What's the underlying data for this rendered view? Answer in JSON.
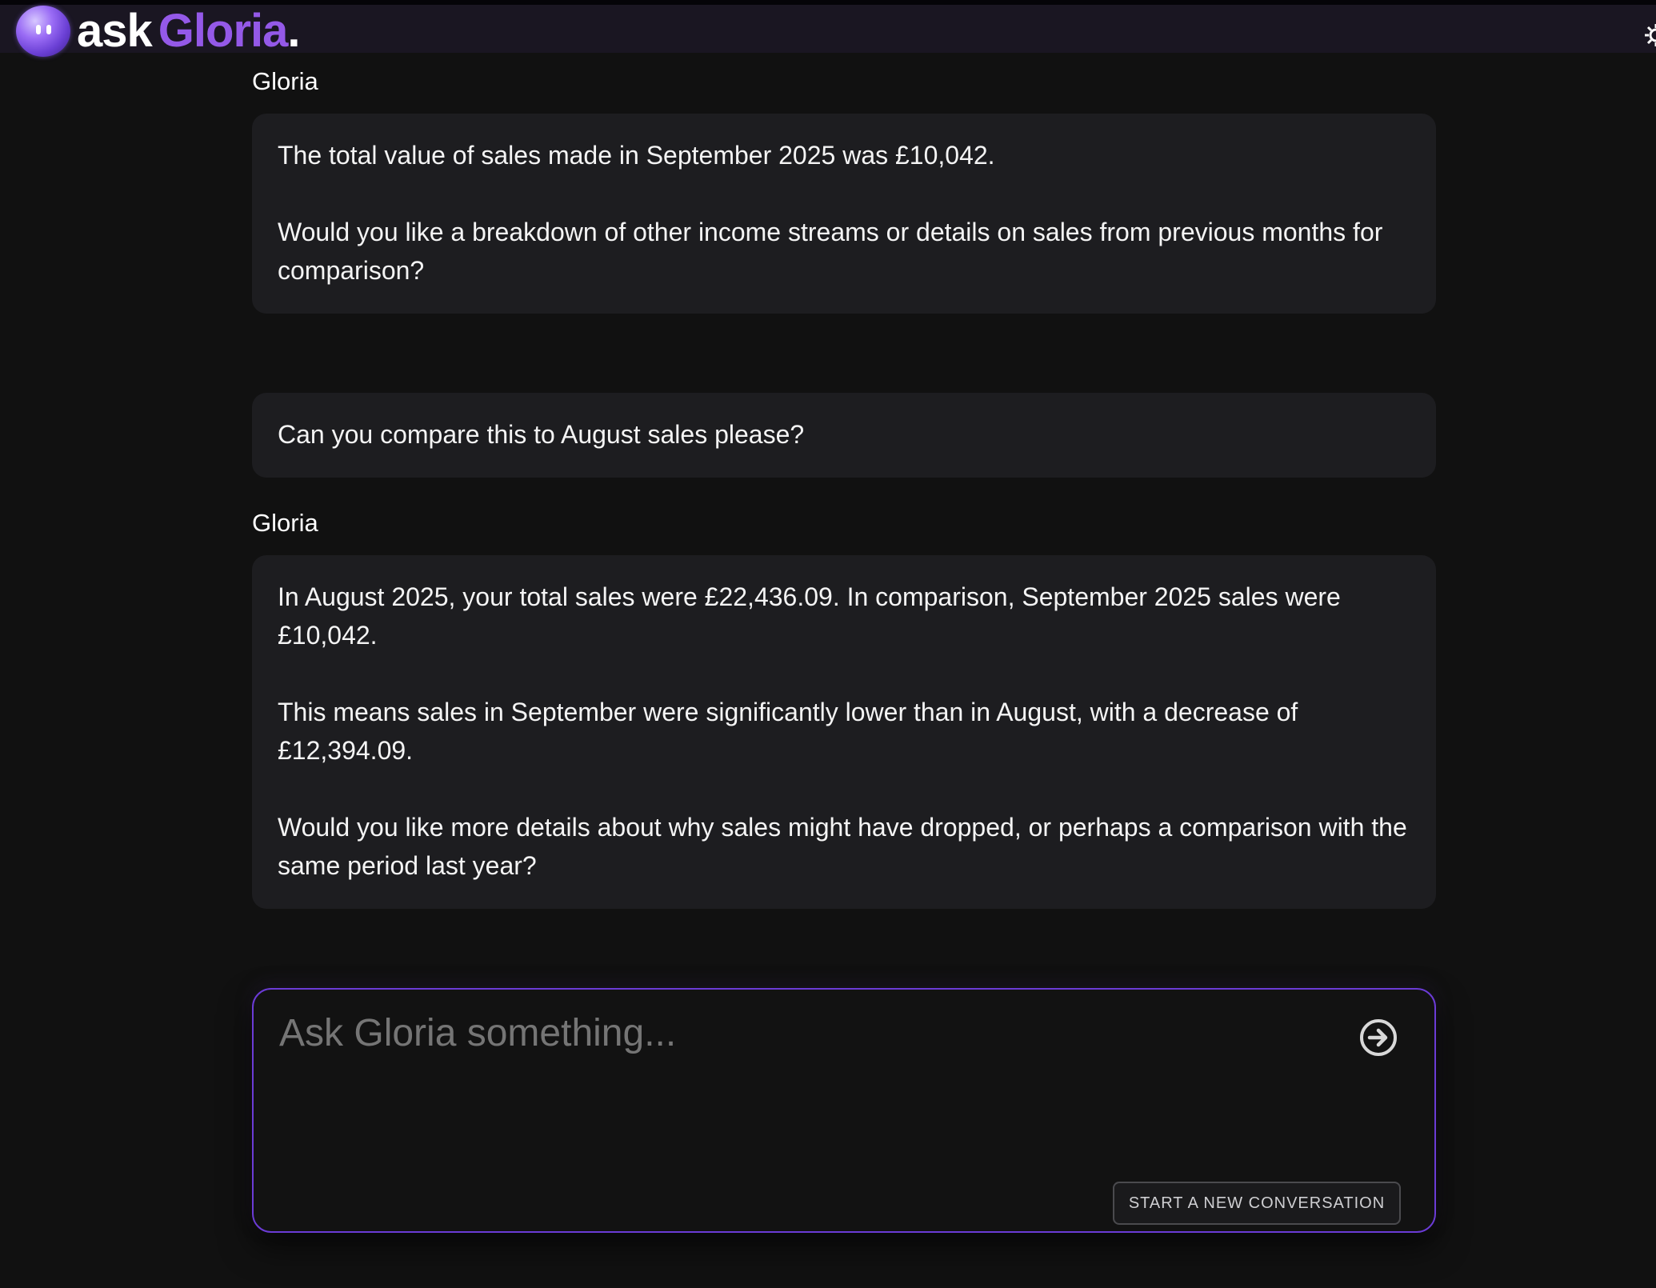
{
  "header": {
    "logo_ask": "ask",
    "logo_gloria": "Gloria",
    "logo_dot": "."
  },
  "messages": [
    {
      "sender": "Gloria",
      "paragraphs": [
        "The total value of sales made in September 2025 was £10,042.",
        "Would you like a breakdown of other income streams or details on sales from previous months for comparison?"
      ]
    },
    {
      "sender": "",
      "paragraphs": [
        "Can you compare this to August sales please?"
      ]
    },
    {
      "sender": "Gloria",
      "paragraphs": [
        "In August 2025, your total sales were £22,436.09. In comparison, September 2025 sales were £10,042.",
        "This means sales in September were significantly lower than in August, with a decrease of £12,394.09.",
        "Would you like more details about why sales might have dropped, or perhaps a comparison with the same period last year?"
      ]
    }
  ],
  "composer": {
    "placeholder": "Ask Gloria something...",
    "value": "",
    "send_icon": "arrow-circle-right-icon",
    "new_conversation_label": "START A NEW CONVERSATION"
  },
  "colors": {
    "accent": "#9459e8",
    "composer_border": "#6b3bd6",
    "background": "#111111",
    "bubble": "#1d1d20"
  }
}
